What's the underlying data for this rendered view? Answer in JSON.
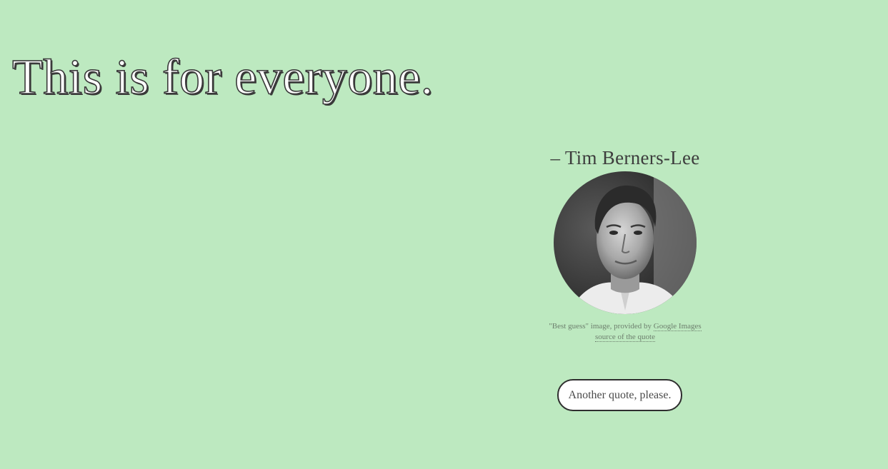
{
  "quote": {
    "text": "This is for everyone."
  },
  "attribution": {
    "author": "– Tim Berners-Lee",
    "image_alt": "Tim Berners-Lee portrait",
    "credit_prefix": "\"Best guess\" image, provided by ",
    "credit_link": "Google Images",
    "source_link": "source of the quote"
  },
  "actions": {
    "another_label": "Another quote, please."
  },
  "colors": {
    "background": "#bde9c0",
    "text": "#3d3d3d",
    "muted": "#6d7f6d"
  }
}
